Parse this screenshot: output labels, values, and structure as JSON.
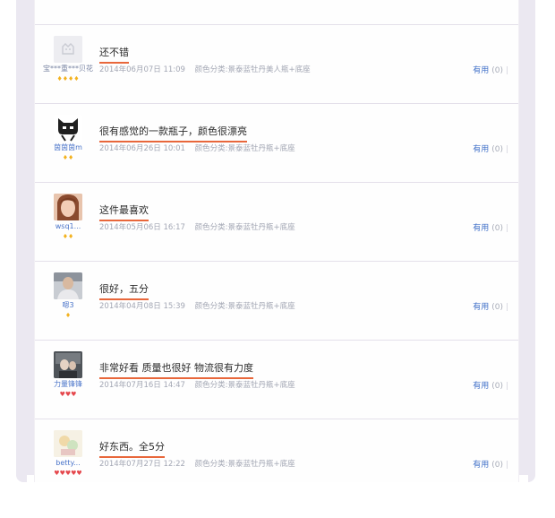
{
  "reviews": [
    {
      "comment": "还不错",
      "user": "宝***重***贝花",
      "level": "♦♦♦♦",
      "date": "2014年06月07日 11:09",
      "spec": "颜色分类:景泰蓝牡丹美人瓶+底座",
      "useful_label": "有用",
      "useful_count": "(0)"
    },
    {
      "comment": "很有感觉的一款瓶子，颜色很漂亮",
      "user": "茵茵茵m",
      "level": "♦♦",
      "date": "2014年06月26日 10:01",
      "spec": "颜色分类:景泰蓝牡丹瓶+底座",
      "useful_label": "有用",
      "useful_count": "(0)"
    },
    {
      "comment": "这件最喜欢",
      "user": "wsq1...",
      "level": "♦♦",
      "date": "2014年05月06日 16:17",
      "spec": "颜色分类:景泰蓝牡丹瓶+底座",
      "useful_label": "有用",
      "useful_count": "(0)"
    },
    {
      "comment": "很好，五分",
      "user": "嗯3",
      "level": "♦",
      "date": "2014年04月08日 15:39",
      "spec": "颜色分类:景泰蓝牡丹瓶+底座",
      "useful_label": "有用",
      "useful_count": "(0)"
    },
    {
      "comment": "非常好看 质量也很好 物流很有力度",
      "user": "力量锋锋",
      "level": "♥♥♥",
      "date": "2014年07月16日 14:47",
      "spec": "颜色分类:景泰蓝牡丹瓶+底座",
      "useful_label": "有用",
      "useful_count": "(0)"
    },
    {
      "comment": "好东西。全5分",
      "user": "betty...",
      "level": "♥♥♥♥♥",
      "date": "2014年07月27日 12:22",
      "spec": "颜色分类:景泰蓝牡丹瓶+底座",
      "useful_label": "有用",
      "useful_count": "(0)"
    }
  ],
  "colors": {
    "accent_underline": "#e8673b",
    "useful_link": "#3f6fc8",
    "username": "#4a74c9",
    "level_gold": "#f3b21f",
    "level_red": "#e5484d"
  }
}
